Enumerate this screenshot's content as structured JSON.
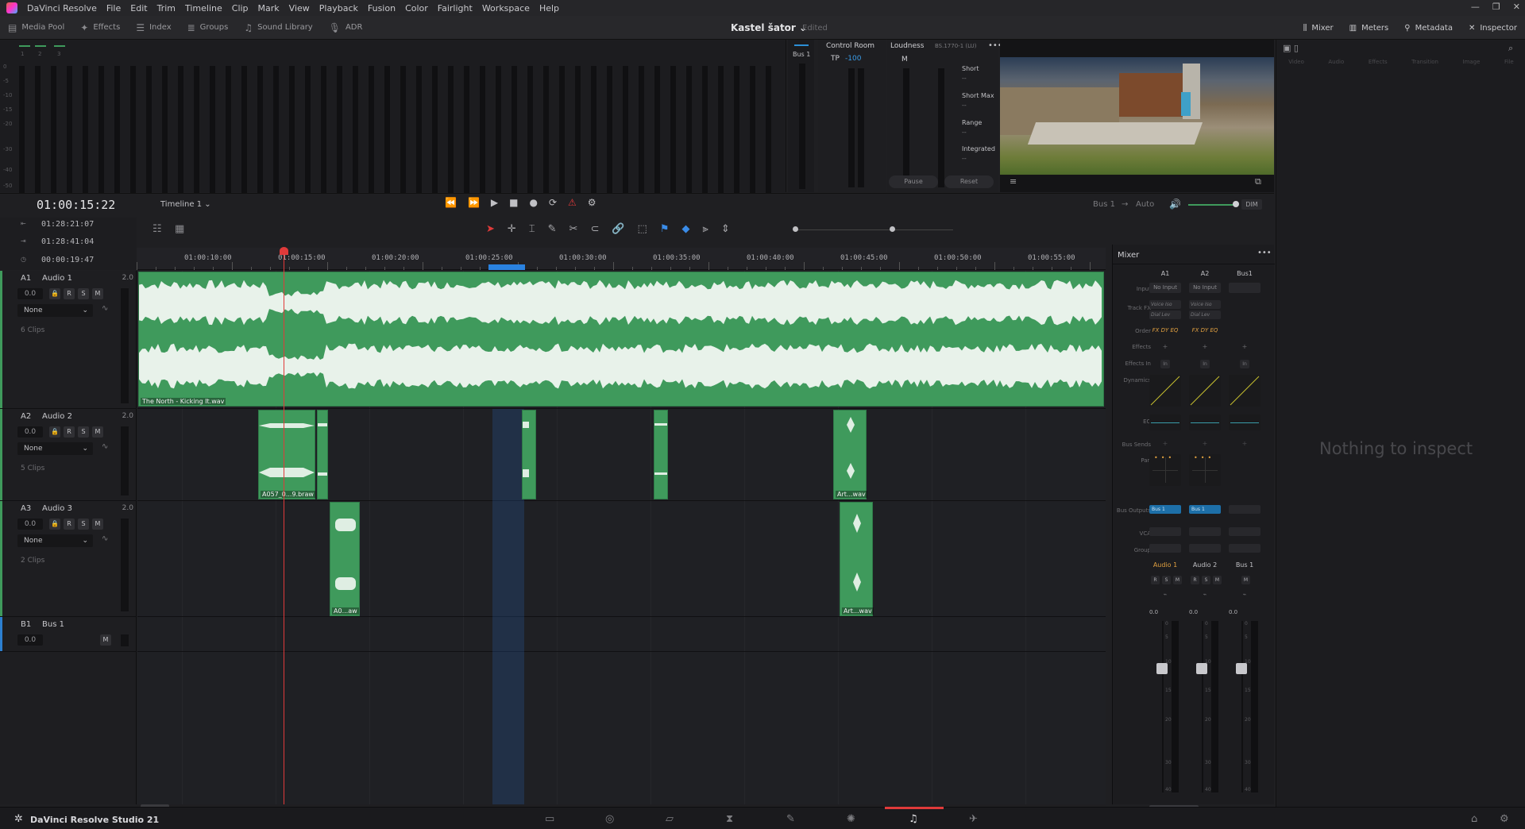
{
  "menubar": {
    "app": "DaVinci Resolve",
    "items": [
      "File",
      "Edit",
      "Trim",
      "Timeline",
      "Clip",
      "Mark",
      "View",
      "Playback",
      "Fusion",
      "Color",
      "Fairlight",
      "Workspace",
      "Help"
    ],
    "window_controls": [
      "—",
      "❐",
      "✕"
    ]
  },
  "toolbar": {
    "left": [
      {
        "icon": "media-pool-icon",
        "label": "Media Pool"
      },
      {
        "icon": "effects-icon",
        "label": "Effects"
      },
      {
        "icon": "index-icon",
        "label": "Index"
      },
      {
        "icon": "groups-icon",
        "label": "Groups"
      },
      {
        "icon": "sound-library-icon",
        "label": "Sound Library"
      },
      {
        "icon": "adr-icon",
        "label": "ADR"
      }
    ],
    "project_title": "Kastel šator",
    "status": "Edited",
    "right": [
      {
        "icon": "mixer-icon",
        "label": "Mixer"
      },
      {
        "icon": "meters-icon",
        "label": "Meters"
      },
      {
        "icon": "metadata-icon",
        "label": "Metadata"
      },
      {
        "icon": "inspector-icon",
        "label": "Inspector"
      }
    ]
  },
  "meters": {
    "scale": [
      "0",
      "-5",
      "-10",
      "-15",
      "-20",
      "-30",
      "-40",
      "-50"
    ],
    "top_labels": [
      "1",
      "2",
      "3"
    ],
    "bus_label": "Bus 1"
  },
  "control_room": {
    "title": "Control Room",
    "tp_label": "TP",
    "tp_value": "-100"
  },
  "loudness": {
    "title": "Loudness",
    "standard": "BS.1770-1 (LU)",
    "m_label": "M",
    "fields": [
      {
        "label": "Short",
        "value": "--"
      },
      {
        "label": "Short Max",
        "value": "--"
      },
      {
        "label": "Range",
        "value": "--"
      },
      {
        "label": "Integrated",
        "value": "--"
      }
    ],
    "pause": "Pause",
    "reset": "Reset"
  },
  "inspector": {
    "tabs": [
      "Video",
      "Audio",
      "Effects",
      "Transition",
      "Image",
      "File"
    ],
    "empty": "Nothing to inspect"
  },
  "transport": {
    "timecode": "01:00:15:22",
    "timeline": "Timeline 1",
    "bus": "Bus 1",
    "auto": "Auto",
    "dim": "DIM"
  },
  "info": {
    "in": "01:28:21:07",
    "out": "01:28:41:04",
    "duration": "00:00:19:47"
  },
  "ruler": [
    "01:00:10:00",
    "01:00:15:00",
    "01:00:20:00",
    "01:00:25:00",
    "01:00:30:00",
    "01:00:35:00",
    "01:00:40:00",
    "01:00:45:00",
    "01:00:50:00",
    "01:00:55:00"
  ],
  "tracks": [
    {
      "id": "A1",
      "name": "Audio 1",
      "ch": "2.0",
      "vol": "0.0",
      "fx": "None",
      "clips": "6 Clips"
    },
    {
      "id": "A2",
      "name": "Audio 2",
      "ch": "2.0",
      "vol": "0.0",
      "fx": "None",
      "clips": "5 Clips"
    },
    {
      "id": "A3",
      "name": "Audio 3",
      "ch": "2.0",
      "vol": "0.0",
      "fx": "None",
      "clips": "2 Clips"
    },
    {
      "id": "B1",
      "name": "Bus 1",
      "vol": "0.0"
    }
  ],
  "clip_names": {
    "a1": "The North - Kicking It.wav",
    "a2_1": "A057_0...9.braw",
    "a2_5": "Art...wav",
    "a3_1": "A0...aw",
    "a3_2": "Art...wav"
  },
  "mixer": {
    "title": "Mixer",
    "cols": [
      "A1",
      "A2",
      "Bus1"
    ],
    "rows": {
      "input": "Input",
      "trackfx": "Track FX",
      "order": "Order",
      "effects": "Effects",
      "effectsin": "Effects In",
      "dynamics": "Dynamics",
      "eq": "EQ",
      "bussends": "Bus Sends",
      "pan": "Pan",
      "busout": "Bus Outputs",
      "vca": "VCA",
      "group": "Group"
    },
    "input_val": "No Input",
    "fx1": "Voice Iso",
    "fx2": "Dial Lev",
    "order_val": "FX DY EQ",
    "in_val": "In",
    "busout_val": "Bus 1",
    "names": [
      "Audio 1",
      "Audio 2",
      "Bus 1"
    ],
    "vol": "0.0",
    "fader_scale": [
      "0",
      "5",
      "10",
      "15",
      "20",
      "30",
      "40",
      "50"
    ]
  },
  "footer": {
    "app": "DaVinci Resolve Studio 21",
    "pages": [
      "media-icon",
      "cut-icon",
      "edit-icon",
      "fusion-icon",
      "color-icon",
      "fairlight-icon",
      "deliver-icon"
    ]
  }
}
